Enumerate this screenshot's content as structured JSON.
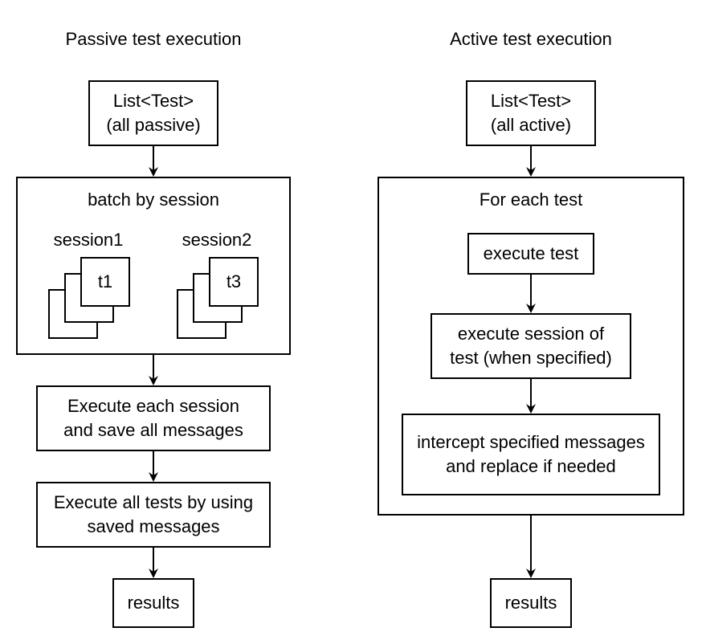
{
  "diagram": {
    "passive": {
      "title": "Passive test execution",
      "input": "List<Test>\n(all passive)",
      "batch": {
        "title": "batch by session",
        "sessions": [
          {
            "label": "session1",
            "top_test": "t1"
          },
          {
            "label": "session2",
            "top_test": "t3"
          }
        ]
      },
      "step_execute_sessions": "Execute each session\nand save all messages",
      "step_execute_tests": "Execute all tests by using\nsaved messages",
      "output": "results"
    },
    "active": {
      "title": "Active test execution",
      "input": "List<Test>\n(all active)",
      "loop": {
        "title": "For each test",
        "step_execute_test": "execute test",
        "step_execute_session": "execute session of\ntest (when specified)",
        "step_intercept": "intercept specified messages\nand replace if needed"
      },
      "output": "results"
    }
  }
}
